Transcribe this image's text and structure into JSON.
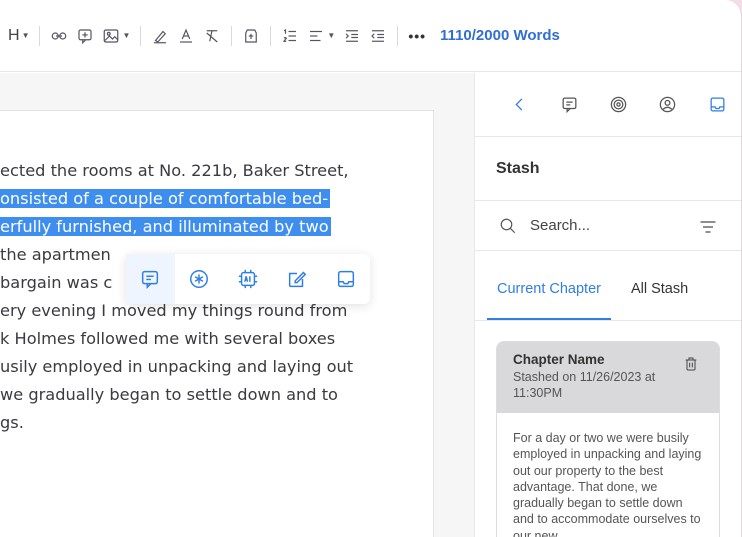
{
  "toolbar": {
    "heading": "H",
    "more": "•••",
    "word_count": "1110/2000 Words",
    "icons": [
      "heading-icon",
      "link-icon",
      "comment-add-icon",
      "image-icon",
      "highlighter-icon",
      "text-color-icon",
      "clear-format-icon",
      "template-icon",
      "numbered-list-icon",
      "align-icon",
      "indent-icon",
      "outdent-icon"
    ]
  },
  "document": {
    "lines": [
      {
        "text": "ected the rooms at No. 221b, Baker Street,",
        "highlight": false
      },
      {
        "text": "onsisted of a couple of comfortable bed-",
        "highlight": true
      },
      {
        "text": "erfully furnished, and illuminated by two",
        "highlight": true
      },
      {
        "text": " the apartmen",
        "highlight": false
      },
      {
        "text": " bargain was c",
        "highlight": false
      },
      {
        "text": "ery evening I moved my things round from",
        "highlight": false
      },
      {
        "text": "k Holmes followed me with several boxes",
        "highlight": false
      },
      {
        "text": "usily employed in unpacking and laying out",
        "highlight": false
      },
      {
        "text": " we gradually began to settle down and to",
        "highlight": false
      },
      {
        "text": "gs.",
        "highlight": false
      }
    ]
  },
  "floating_toolbar": {
    "icons": [
      "comment-icon",
      "asterisk-icon",
      "ai-chip-icon",
      "edit-icon",
      "stash-icon"
    ]
  },
  "sidebar": {
    "title": "Stash",
    "search_placeholder": "Search...",
    "tabs": [
      {
        "label": "Current Chapter",
        "active": true
      },
      {
        "label": "All Stash",
        "active": false
      }
    ],
    "card": {
      "name": "Chapter Name",
      "meta": "Stashed on 11/26/2023 at 11:30PM",
      "body": "For a day or two we were busily employed in unpacking and laying out our property to the best advantage. That done, we gradually began to settle down and to accommodate ourselves to our new"
    }
  },
  "colors": {
    "accent": "#2f7ee6",
    "highlight": "#3e8ef0",
    "card_header": "#d9d9db"
  }
}
